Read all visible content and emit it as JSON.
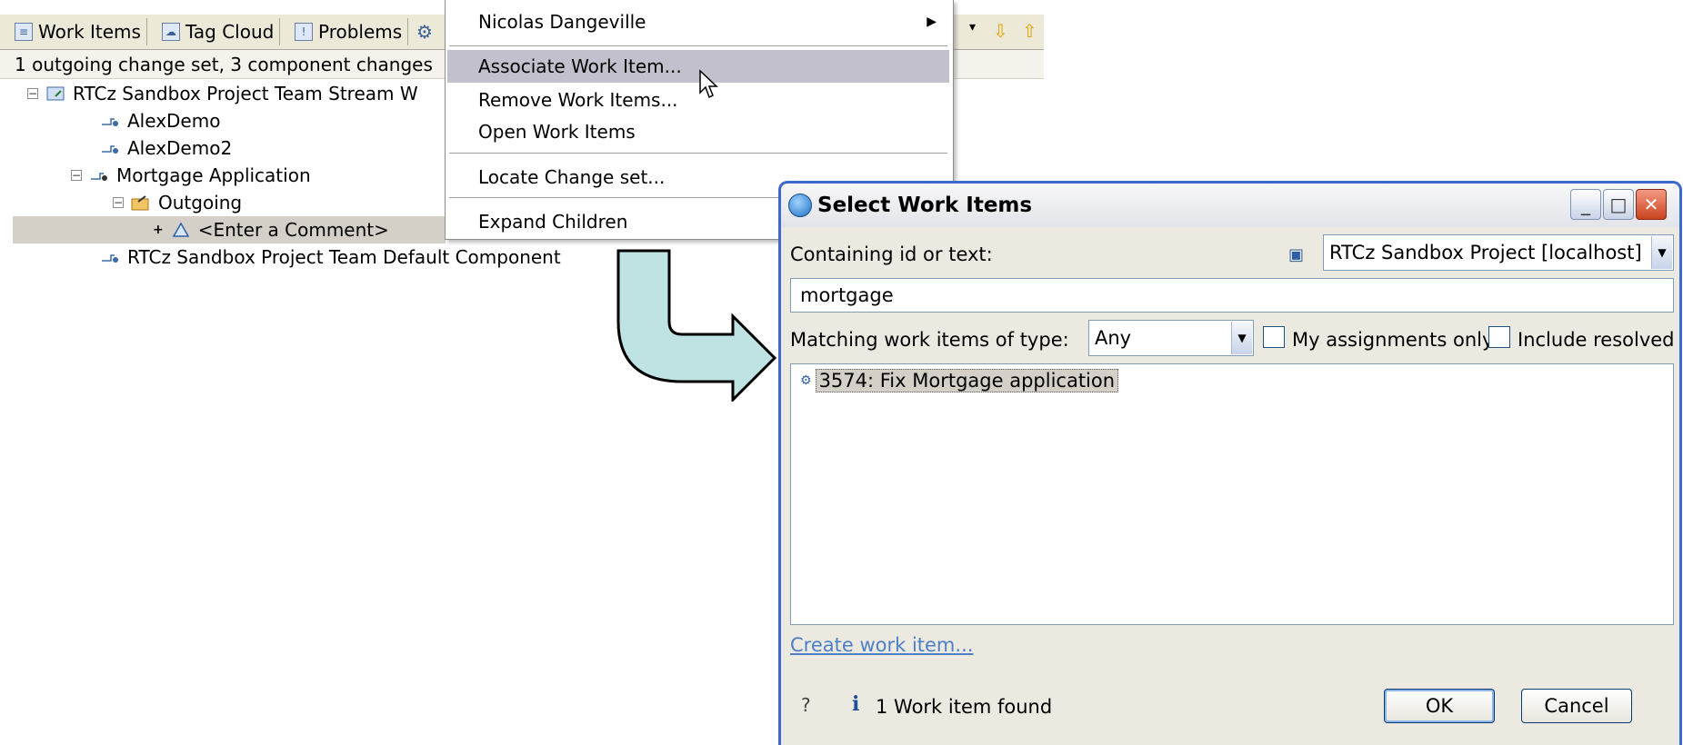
{
  "view": {
    "tabs": [
      {
        "label": "Work Items"
      },
      {
        "label": "Tag Cloud"
      },
      {
        "label": "Problems"
      }
    ],
    "status": "1 outgoing change set, 3 component changes",
    "tree": [
      {
        "label": "RTCz Sandbox Project Team Stream W"
      },
      {
        "label": "AlexDemo"
      },
      {
        "label": "AlexDemo2"
      },
      {
        "label": "Mortgage Application"
      },
      {
        "label": "Outgoing"
      },
      {
        "label": "<Enter a Comment>"
      },
      {
        "label": "RTCz Sandbox Project Team Default Component"
      }
    ]
  },
  "context_menu": {
    "items": [
      {
        "label": "Nicolas Dangeville"
      },
      {
        "label": "Associate Work Item..."
      },
      {
        "label": "Remove Work Items..."
      },
      {
        "label": "Open Work Items"
      },
      {
        "label": "Locate Change set..."
      },
      {
        "label": "Expand Children"
      }
    ]
  },
  "dialog": {
    "title": "Select Work Items",
    "containing_label": "Containing id or text:",
    "repository": "RTCz Sandbox Project [localhost]",
    "search_value": "mortgage",
    "type_label": "Matching work items of type:",
    "type_value": "Any",
    "my_assignments_label": "My assignments only",
    "include_resolved_label": "Include resolved",
    "results": [
      {
        "label": "3574: Fix Mortgage application"
      }
    ],
    "create_link": "Create work item...",
    "status": "1 Work item found",
    "ok_label": "OK",
    "cancel_label": "Cancel"
  }
}
